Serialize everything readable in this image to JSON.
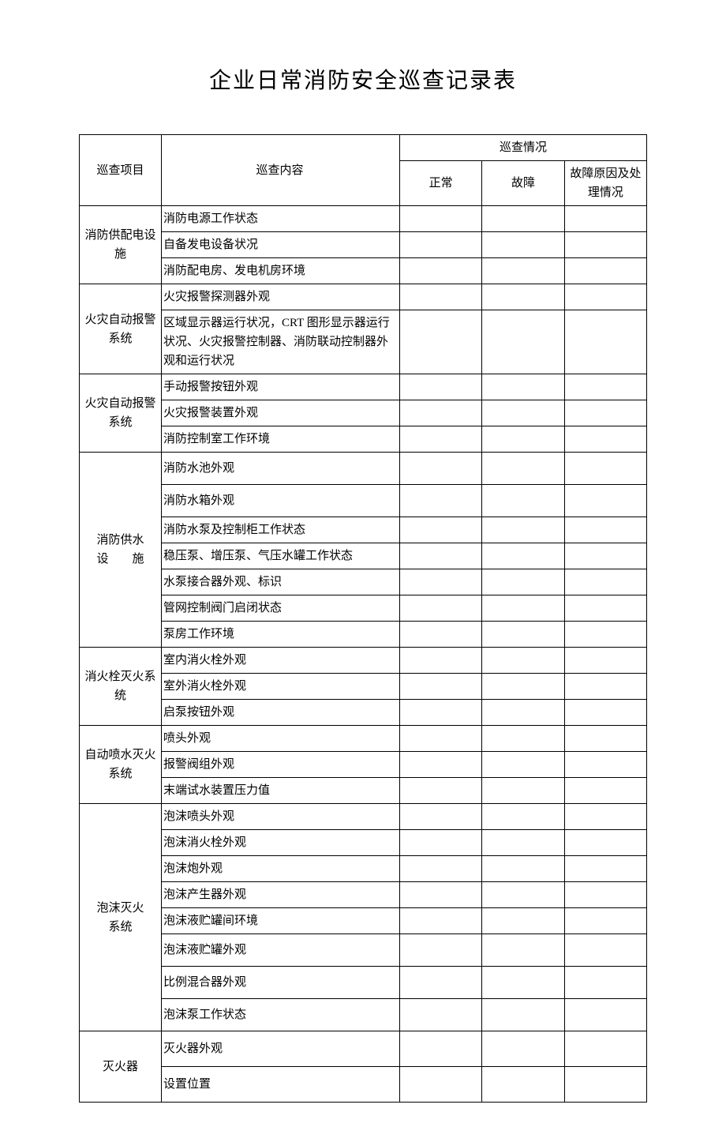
{
  "title": "企业日常消防安全巡查记录表",
  "headers": {
    "category": "巡查项目",
    "content": "巡查内容",
    "status": "巡查情况",
    "normal": "正常",
    "fault": "故障",
    "reason": "故障原因及处理情况"
  },
  "groups": [
    {
      "name": "消防供配电设施",
      "items": [
        "消防电源工作状态",
        "自备发电设备状况",
        "消防配电房、发电机房环境"
      ]
    },
    {
      "name": "火灾自动报警系统",
      "items": [
        "火灾报警探测器外观",
        "区域显示器运行状况，CRT 图形显示器运行状况、火灾报警控制器、消防联动控制器外观和运行状况"
      ]
    },
    {
      "name": "火灾自动报警系统",
      "items": [
        "手动报警按钮外观",
        "火灾报警装置外观",
        "消防控制室工作环境"
      ]
    },
    {
      "name_l1": "消防供水",
      "name_l2": "设　　施",
      "items": [
        "消防水池外观",
        "消防水箱外观",
        "消防水泵及控制柜工作状态",
        "稳压泵、增压泵、气压水罐工作状态",
        "水泵接合器外观、标识",
        "管网控制阀门启闭状态",
        "泵房工作环境"
      ]
    },
    {
      "name": "消火栓灭火系统",
      "items": [
        "室内消火栓外观",
        "室外消火栓外观",
        "启泵按钮外观"
      ]
    },
    {
      "name": "自动喷水灭火系统",
      "items": [
        "喷头外观",
        "报警阀组外观",
        "末端试水装置压力值"
      ]
    },
    {
      "name_l1": "泡沫灭火",
      "name_l2": "系统",
      "items": [
        "泡沫喷头外观",
        "泡沫消火栓外观",
        "泡沫炮外观",
        "泡沫产生器外观",
        "泡沫液贮罐间环境",
        "泡沫液贮罐外观",
        "比例混合器外观",
        "泡沫泵工作状态"
      ]
    },
    {
      "name": "灭火器",
      "items": [
        "灭火器外观",
        "设置位置"
      ]
    }
  ]
}
